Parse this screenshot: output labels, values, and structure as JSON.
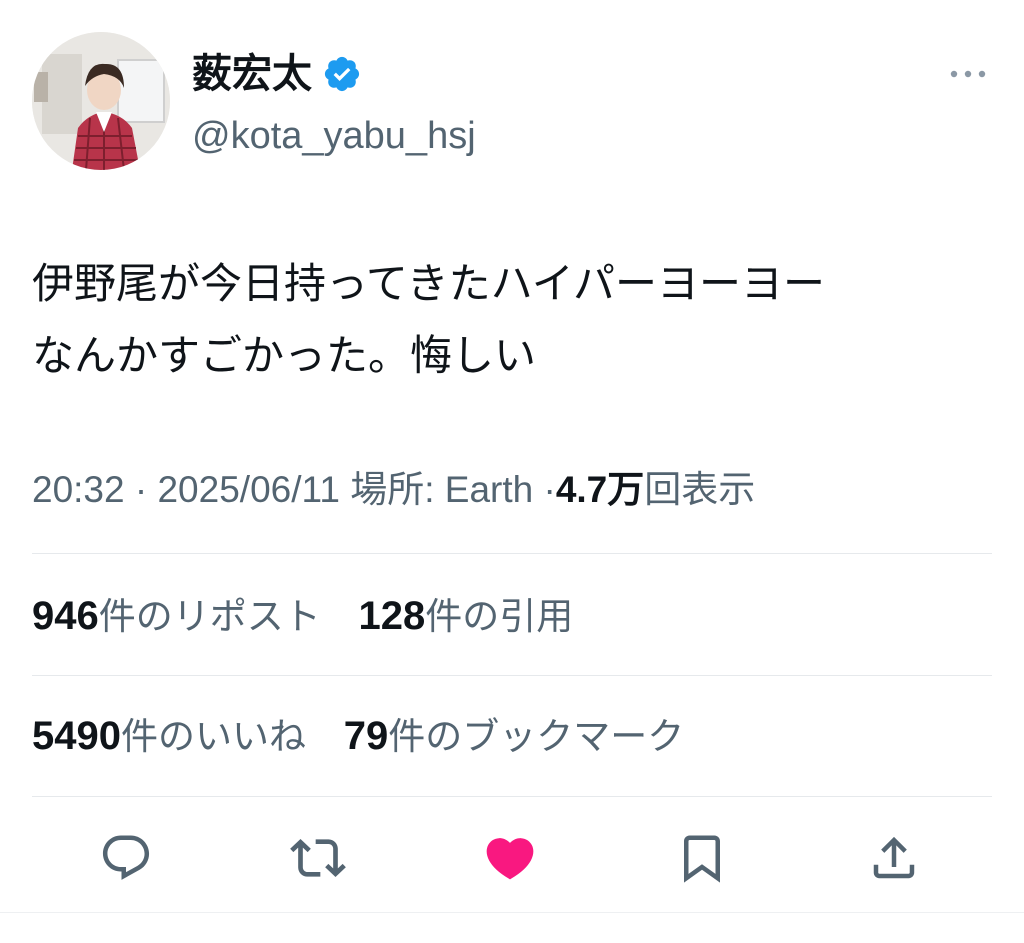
{
  "user": {
    "display_name": "薮宏太",
    "handle": "@kota_yabu_hsj",
    "verified": true,
    "verified_color": "#1d9bf0"
  },
  "tweet": {
    "text": "伊野尾が今日持ってきたハイパーヨーヨー\nなんかすごかった。悔しい"
  },
  "meta": {
    "time": "20:32",
    "separator": "·",
    "date": "2025/06/11",
    "location_label": "場所: Earth",
    "views_count": "4.7万",
    "views_label": "回表示"
  },
  "stats": {
    "reposts_count": "946",
    "reposts_label": "件のリポスト",
    "quotes_count": "128",
    "quotes_label": "件の引用",
    "likes_count": "5490",
    "likes_label": "件のいいね",
    "bookmarks_count": "79",
    "bookmarks_label": "件のブックマーク"
  },
  "actions": {
    "reply_icon": "reply-icon",
    "repost_icon": "repost-icon",
    "like_icon": "heart-icon",
    "like_active": true,
    "like_color": "#f91880",
    "bookmark_icon": "bookmark-icon",
    "share_icon": "share-icon"
  },
  "colors": {
    "text_primary": "#0f1419",
    "text_secondary": "#536471",
    "icon": "#536471",
    "divider": "#e6e9ec"
  }
}
